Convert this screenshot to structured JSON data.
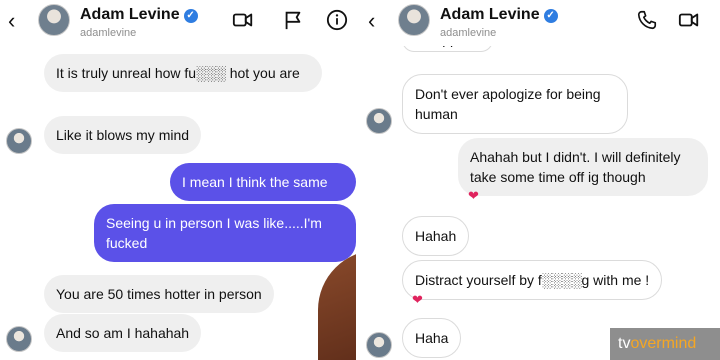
{
  "left": {
    "header": {
      "name": "Adam Levine",
      "handle": "adamlevine"
    },
    "messages": [
      {
        "text": "It is truly unreal how fu░░░ hot you are"
      },
      {
        "text": "Like it blows my mind"
      },
      {
        "text": "I mean I think the same"
      },
      {
        "text": "Seeing u in person I was like.....I'm fucked"
      },
      {
        "text": "You are 50 times hotter in person"
      },
      {
        "text": "And so am I hahahah"
      }
    ]
  },
  "right": {
    "header": {
      "name": "Adam Levine",
      "handle": "adamlevine"
    },
    "messages": [
      {
        "text": "It happens"
      },
      {
        "text": "Don't ever apologize for being human"
      },
      {
        "text": "Ahahah but I didn't. I will definitely take some time off ig though",
        "reaction": "❤"
      },
      {
        "text": "Hahah"
      },
      {
        "text": "Distract yourself by f░░░░g with me !",
        "reaction": "❤"
      },
      {
        "text": "Haha"
      }
    ]
  },
  "watermark": {
    "prefix": "tv",
    "suffix": "overmind"
  },
  "colors": {
    "outgoing": "#5b51e8",
    "incoming": "#efefef",
    "verified": "#2f7de1",
    "heart": "#e0245e"
  },
  "icons": [
    "back-arrow-icon",
    "verified-icon",
    "video-call-icon",
    "flag-icon",
    "info-icon",
    "phone-icon"
  ]
}
